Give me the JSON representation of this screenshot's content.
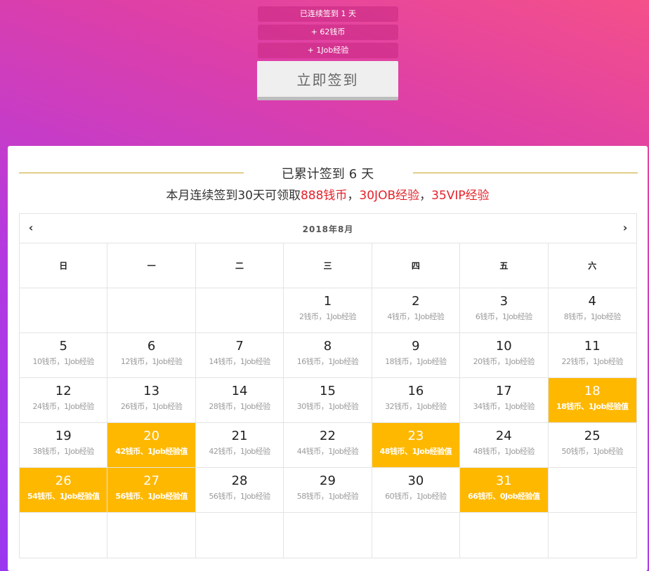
{
  "top": {
    "streak_text": "已连续签到 1 天",
    "coins_text": "+ 62钱币",
    "exp_text": "+ 1Job经验",
    "sign_button": "立即签到"
  },
  "summary": {
    "total_prefix": "已累计签到",
    "total_days": "6",
    "total_suffix": "天",
    "reward_prefix": "本月连续签到30天可领取",
    "reward_coins": "888钱币",
    "sep1": "，",
    "reward_job": "30JOB经验",
    "sep2": "，",
    "reward_vip": "35VIP经验"
  },
  "calendar": {
    "title": "2018年8月",
    "prev_icon": "chevron-left-icon",
    "next_icon": "chevron-right-icon",
    "weekdays": [
      "日",
      "一",
      "二",
      "三",
      "四",
      "五",
      "六"
    ],
    "accent_color": "#ffb800",
    "weeks": [
      [
        null,
        null,
        null,
        {
          "day": "1",
          "reward": "2钱币，1Job经验",
          "signed": false
        },
        {
          "day": "2",
          "reward": "4钱币，1Job经验",
          "signed": false
        },
        {
          "day": "3",
          "reward": "6钱币，1Job经验",
          "signed": false
        },
        {
          "day": "4",
          "reward": "8钱币，1Job经验",
          "signed": false
        }
      ],
      [
        {
          "day": "5",
          "reward": "10钱币，1Job经验",
          "signed": false
        },
        {
          "day": "6",
          "reward": "12钱币，1Job经验",
          "signed": false
        },
        {
          "day": "7",
          "reward": "14钱币，1Job经验",
          "signed": false
        },
        {
          "day": "8",
          "reward": "16钱币，1Job经验",
          "signed": false
        },
        {
          "day": "9",
          "reward": "18钱币，1Job经验",
          "signed": false
        },
        {
          "day": "10",
          "reward": "20钱币，1Job经验",
          "signed": false
        },
        {
          "day": "11",
          "reward": "22钱币，1Job经验",
          "signed": false
        }
      ],
      [
        {
          "day": "12",
          "reward": "24钱币，1Job经验",
          "signed": false
        },
        {
          "day": "13",
          "reward": "26钱币，1Job经验",
          "signed": false
        },
        {
          "day": "14",
          "reward": "28钱币，1Job经验",
          "signed": false
        },
        {
          "day": "15",
          "reward": "30钱币，1Job经验",
          "signed": false
        },
        {
          "day": "16",
          "reward": "32钱币，1Job经验",
          "signed": false
        },
        {
          "day": "17",
          "reward": "34钱币，1Job经验",
          "signed": false
        },
        {
          "day": "18",
          "reward": "18钱币、1Job经验值",
          "signed": true
        }
      ],
      [
        {
          "day": "19",
          "reward": "38钱币，1Job经验",
          "signed": false
        },
        {
          "day": "20",
          "reward": "42钱币、1Job经验值",
          "signed": true
        },
        {
          "day": "21",
          "reward": "42钱币，1Job经验",
          "signed": false
        },
        {
          "day": "22",
          "reward": "44钱币，1Job经验",
          "signed": false
        },
        {
          "day": "23",
          "reward": "48钱币、1Job经验值",
          "signed": true
        },
        {
          "day": "24",
          "reward": "48钱币，1Job经验",
          "signed": false
        },
        {
          "day": "25",
          "reward": "50钱币，1Job经验",
          "signed": false
        }
      ],
      [
        {
          "day": "26",
          "reward": "54钱币、1Job经验值",
          "signed": true
        },
        {
          "day": "27",
          "reward": "56钱币、1Job经验值",
          "signed": true
        },
        {
          "day": "28",
          "reward": "56钱币，1Job经验",
          "signed": false
        },
        {
          "day": "29",
          "reward": "58钱币，1Job经验",
          "signed": false
        },
        {
          "day": "30",
          "reward": "60钱币，1Job经验",
          "signed": false
        },
        {
          "day": "31",
          "reward": "66钱币、0Job经验值",
          "signed": true
        },
        null
      ],
      [
        null,
        null,
        null,
        null,
        null,
        null,
        null
      ]
    ]
  }
}
